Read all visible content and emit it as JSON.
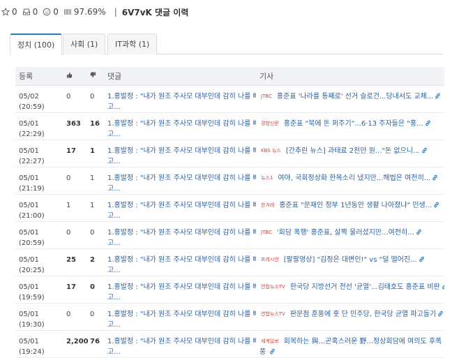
{
  "header": {
    "star_count": "0",
    "box_count": "0",
    "smile_count": "0",
    "bar_value": "97.69%",
    "separator": "|",
    "title": "6V7vK 댓글 이력"
  },
  "tabs": [
    {
      "label": "정치 (100)"
    },
    {
      "label": "사회 (1)"
    },
    {
      "label": "IT과학 (1)"
    }
  ],
  "table": {
    "headers": {
      "date": "등록",
      "comment": "댓글",
      "article": "기사"
    },
    "rows": [
      {
        "date": "05/02 (20:59)",
        "up": "0",
        "down": "0",
        "comment1": "1.홍발정 : \"내가 원조 주사모 대부인데 감히 나를 빼",
        "comment2": "고...",
        "badge": "JTBC",
        "article1": "홍준표 '나라를 통째로' 선거 슬로건...당내서도 교체...",
        "article2": ""
      },
      {
        "date": "05/01 (22:29)",
        "up": "363",
        "down": "16",
        "comment1": "1.홍발정 : \"내가 원조 주사모 대부인데 감히 나를 빼",
        "comment2": "고...",
        "badge": "경향신문",
        "article1": "홍준표 \"북에 돈 퍼주기\"...6·13 주자들은 \"홍...",
        "article2": ""
      },
      {
        "date": "05/01 (22:27)",
        "up": "17",
        "down": "1",
        "comment1": "1.홍발정 : \"내가 원조 주사모 대부인데 감히 나를 빼",
        "comment2": "고...",
        "badge": "KBS 뉴스",
        "article1": "[간추린 뉴스] 과태료 2천만 원...\"돈 없으니...",
        "article2": ""
      },
      {
        "date": "05/01 (21:19)",
        "up": "0",
        "down": "1",
        "comment1": "1.홍발정 : \"내가 원조 주사모 대부인데 감히 나를 빼",
        "comment2": "고...",
        "badge": "뉴스1",
        "article1": "여야, 국회정상화 한목소리 냈지만...해법은 여전히...",
        "article2": ""
      },
      {
        "date": "05/01 (21:00)",
        "up": "1",
        "down": "1",
        "comment1": "1.홍발정 : \"내가 원조 주사모 대부인데 감히 나를 빼",
        "comment2": "고...",
        "badge": "한겨레",
        "article1": "홍준표 \"문재인 정부 1년동안 생활 나아졌냐\" 민생...",
        "article2": ""
      },
      {
        "date": "05/01 (20:59)",
        "up": "0",
        "down": "0",
        "comment1": "1.홍발정 : \"내가 원조 주사모 대부인데 감히 나를 빼",
        "comment2": "고...",
        "badge": "JTBC",
        "article1": "'회담 폭행' 홍준표, 살짝 물러섰지만...여전히...",
        "article2": ""
      },
      {
        "date": "05/01 (20:25)",
        "up": "25",
        "down": "2",
        "comment1": "1.홍발정 : \"내가 원조 주사모 대부인데 감히 나를 빼",
        "comment2": "고...",
        "badge": "프레시안",
        "article1": "[팔팔영상] \"김정은 대변인!\" vs \"덜 떨어진...",
        "article2": ""
      },
      {
        "date": "05/01 (19:59)",
        "up": "17",
        "down": "0",
        "comment1": "1.홍발정 : \"내가 원조 주사모 대부인데 감히 나를 빼",
        "comment2": "고...",
        "badge": "연합뉴스TV",
        "article1": "한국당 지방선거 전선 '균열'...김태호도 홍준표 비판",
        "article2": ""
      },
      {
        "date": "05/01 (19:30)",
        "up": "0",
        "down": "0",
        "comment1": "1.홍발정 : \"내가 원조 주사모 대부인데 감히 나를 빼",
        "comment2": "고...",
        "badge": "연합뉴스TV",
        "article1": "판문점 훈풍에 홋 단 민주당, 한국당 균열 파고들기",
        "article2": ""
      },
      {
        "date": "05/01 (19:24)",
        "up": "2,200",
        "down": "76",
        "comment1": "1.홍발정 : \"내가 원조 주사모 대부인데 감히 나를 빼",
        "comment2": "고...",
        "badge": "세계일보",
        "article1": "회복하는 與...곤혹스러운 野...정상회담에 여의도 후폭",
        "article2": "풍"
      }
    ]
  },
  "colors": {
    "link": "#2b5f9e",
    "accent": "#2b7bb9",
    "badge": "#d0443a"
  }
}
